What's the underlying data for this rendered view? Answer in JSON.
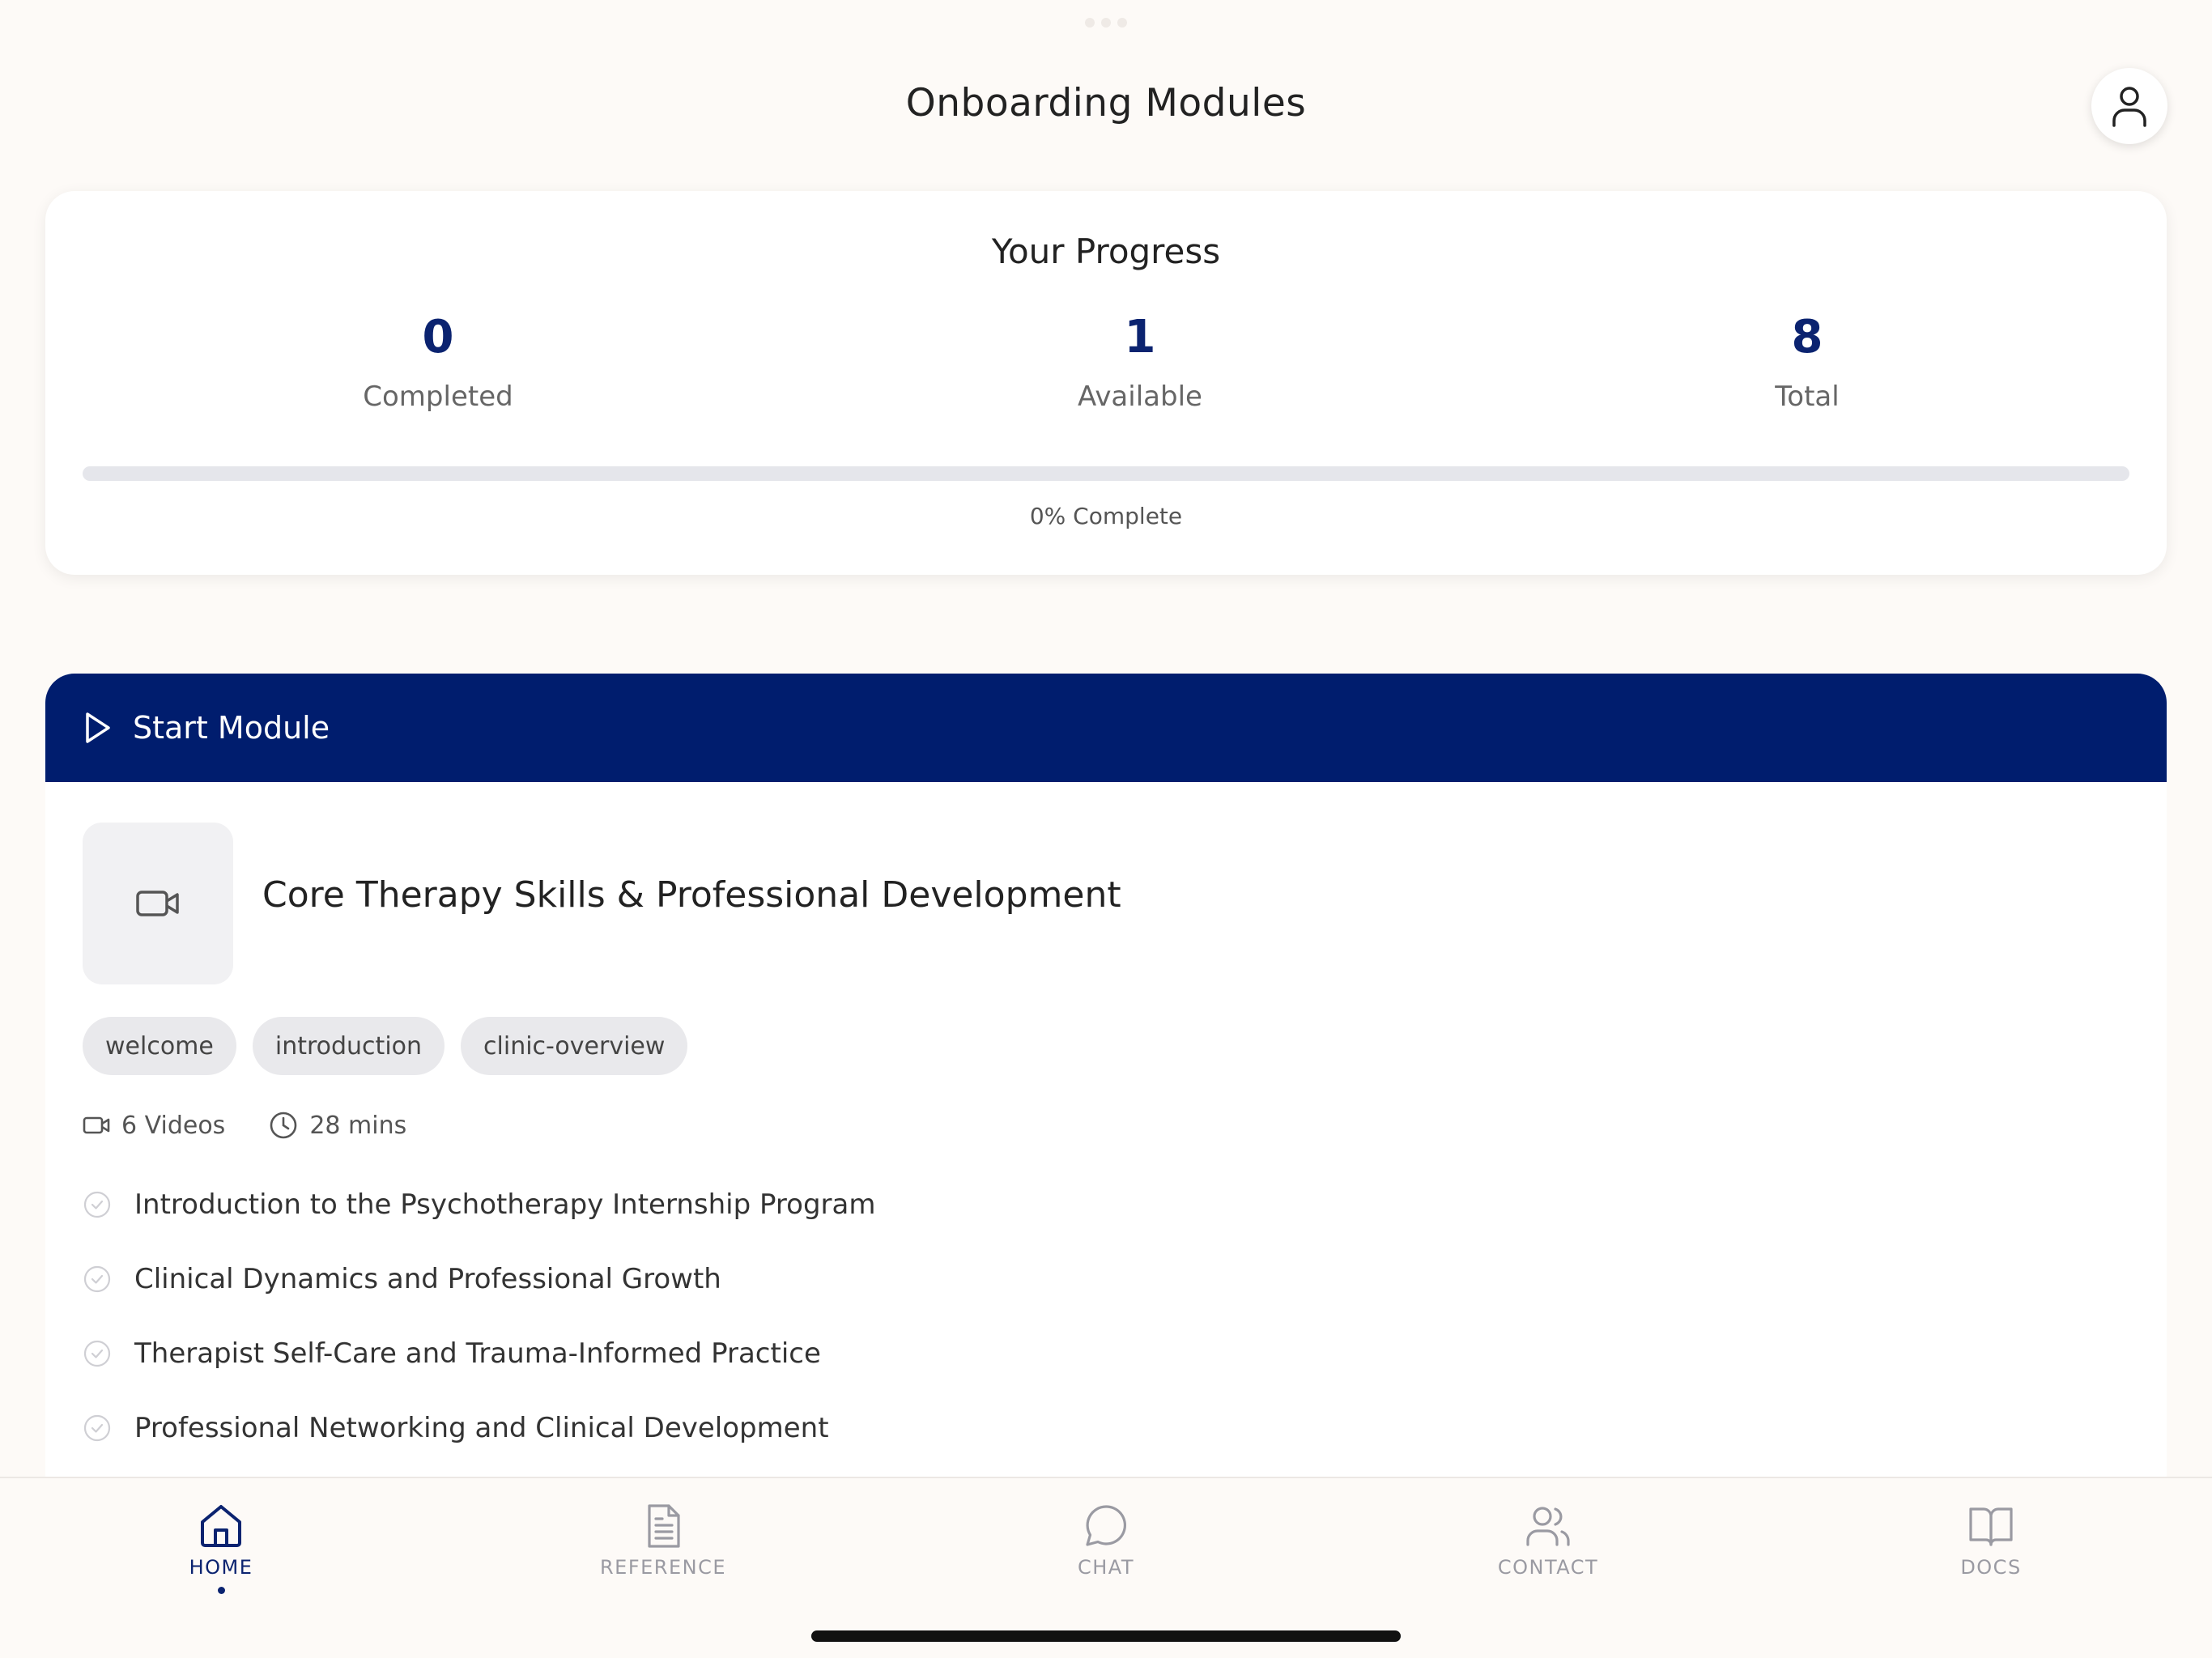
{
  "header": {
    "title": "Onboarding Modules"
  },
  "progress": {
    "title": "Your Progress",
    "stats": [
      {
        "value": "0",
        "label": "Completed"
      },
      {
        "value": "1",
        "label": "Available"
      },
      {
        "value": "8",
        "label": "Total"
      }
    ],
    "percent": 0,
    "percent_label": "0% Complete"
  },
  "module": {
    "header_label": "Start Module",
    "title": "Core Therapy Skills & Professional Development",
    "tags": [
      "welcome",
      "introduction",
      "clinic-overview"
    ],
    "videos": "6 Videos",
    "duration": "28 mins",
    "lessons": [
      "Introduction to the Psychotherapy Internship Program",
      "Clinical Dynamics and Professional Growth",
      "Therapist Self-Care and Trauma-Informed Practice",
      "Professional Networking and Clinical Development"
    ]
  },
  "tabs": [
    {
      "label": "HOME",
      "icon": "home-icon",
      "active": true
    },
    {
      "label": "REFERENCE",
      "icon": "document-icon",
      "active": false
    },
    {
      "label": "CHAT",
      "icon": "chat-bubble-icon",
      "active": false
    },
    {
      "label": "CONTACT",
      "icon": "people-icon",
      "active": false
    },
    {
      "label": "DOCS",
      "icon": "book-icon",
      "active": false
    }
  ],
  "colors": {
    "accent": "#0b2370",
    "module_header": "#001d6e",
    "background": "#fdfaf7",
    "inactive_tab": "#9a9aa2"
  }
}
